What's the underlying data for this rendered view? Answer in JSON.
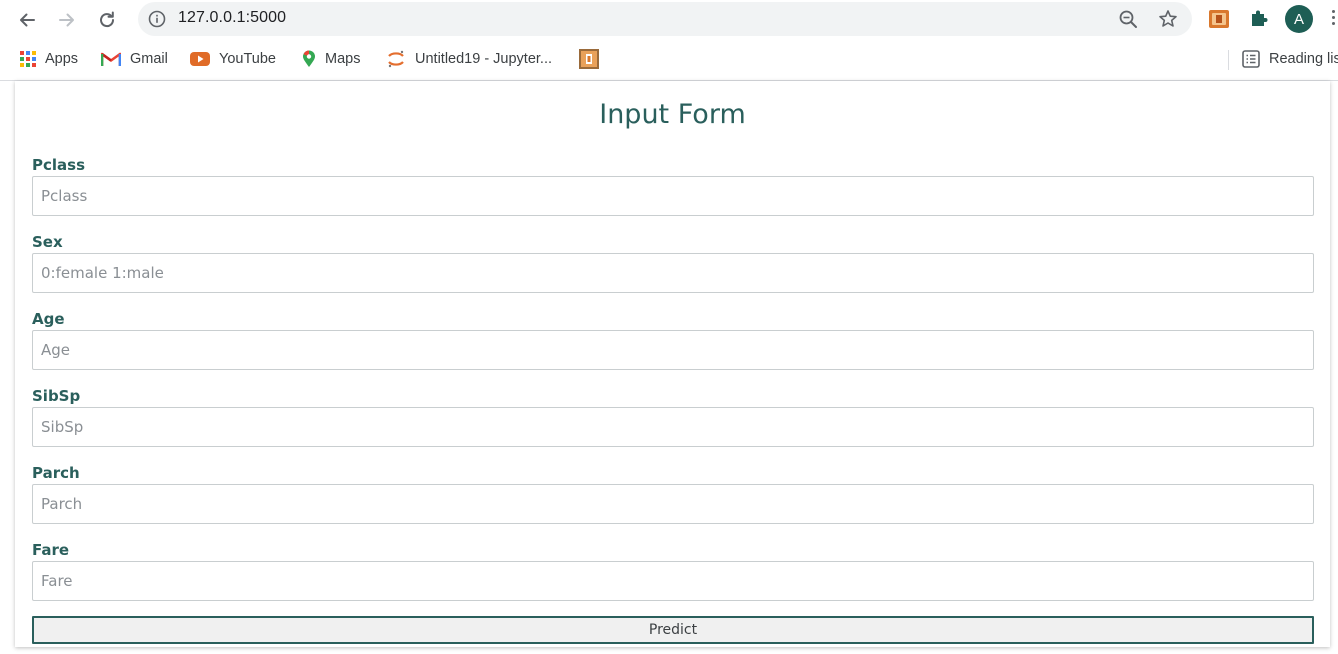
{
  "browser": {
    "url": "127.0.0.1:5000",
    "profile_initial": "A",
    "bookmarks": [
      {
        "label": "Apps",
        "icon": "apps-grid-icon"
      },
      {
        "label": "Gmail",
        "icon": "gmail-icon"
      },
      {
        "label": "YouTube",
        "icon": "youtube-icon"
      },
      {
        "label": "Maps",
        "icon": "maps-pin-icon"
      },
      {
        "label": "Untitled19 - Jupyter...",
        "icon": "jupyter-icon"
      },
      {
        "label": "",
        "icon": "bookmark-extension-icon"
      }
    ],
    "reading_list_label": "Reading lis",
    "colors": {
      "avatar": "#1e5e55",
      "omnibox": "#f1f3f4"
    }
  },
  "form": {
    "title": "Input Form",
    "accent_color": "#2a5f5c",
    "fields": [
      {
        "label": "Pclass",
        "placeholder": "Pclass",
        "value": ""
      },
      {
        "label": "Sex",
        "placeholder": "0:female 1:male",
        "value": ""
      },
      {
        "label": "Age",
        "placeholder": "Age",
        "value": ""
      },
      {
        "label": "SibSp",
        "placeholder": "SibSp",
        "value": ""
      },
      {
        "label": "Parch",
        "placeholder": "Parch",
        "value": ""
      },
      {
        "label": "Fare",
        "placeholder": "Fare",
        "value": ""
      }
    ],
    "submit_label": "Predict"
  }
}
